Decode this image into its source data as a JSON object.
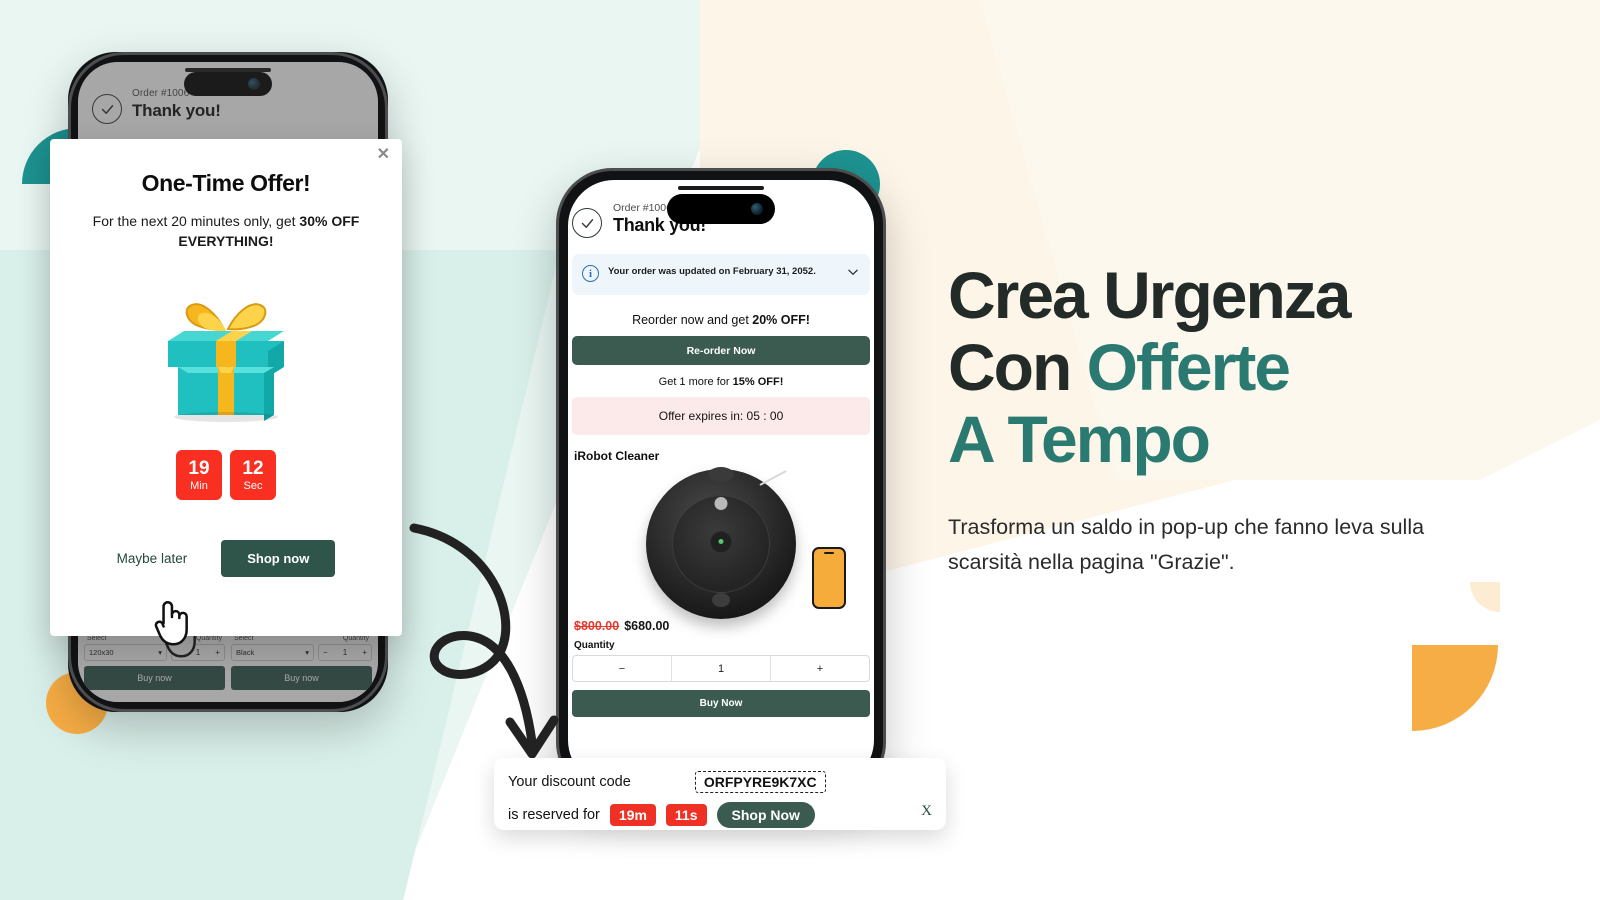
{
  "colors": {
    "teal_dark": "#1d9391",
    "teal_pale": "#b6ded5",
    "orange": "#f7ad45",
    "orange_pale": "#fcecd1",
    "mint_bg": "#e9f6f2",
    "cream_bg": "#fdf5e7",
    "brand_green": "#3b5b50",
    "accent_teal_text": "#2b7a72",
    "alert_red": "#ee3124",
    "timer_red": "#f92f22",
    "price_old_red": "#e23b2e"
  },
  "left_phone": {
    "order_label": "Order #1006",
    "thanks": "Thank you!",
    "check_icon": "check-icon",
    "options": [
      {
        "select_label": "Select",
        "select_value": "120x30",
        "qty_label": "Quantity",
        "qty_minus": "−",
        "qty_value": "1",
        "qty_plus": "+",
        "buy_label": "Buy now"
      },
      {
        "select_label": "Select",
        "select_value": "Black",
        "qty_label": "Quantity",
        "qty_minus": "−",
        "qty_value": "1",
        "qty_plus": "+",
        "buy_label": "Buy now"
      }
    ]
  },
  "popup": {
    "close_icon": "✕",
    "title": "One-Time Offer!",
    "subtitle_part1": "For the next 20 minutes only, get ",
    "subtitle_bold": "30% OFF EVERYTHING!",
    "gift_icon": "gift-box-icon",
    "timer": [
      {
        "value": "19",
        "unit": "Min"
      },
      {
        "value": "12",
        "unit": "Sec"
      }
    ],
    "maybe_later": "Maybe later",
    "shop_now": "Shop now"
  },
  "center_phone": {
    "order_label": "Order #1006",
    "thanks": "Thank you!",
    "check_icon": "check-icon",
    "note_icon": "info-icon",
    "note_text": "Your order was updated on February 31, 2052.",
    "note_chevron": "chevron-down-icon",
    "reorder_text_1": "Reorder now and get ",
    "reorder_text_bold": "20% OFF!",
    "reorder_button": "Re-order Now",
    "upsell_text_1": "Get 1 more for ",
    "upsell_text_bold": "15% OFF!",
    "expire_text": "Offer expires in: 05 : 00",
    "product_name": "iRobot Cleaner",
    "product_icon": "robot-vacuum-icon",
    "price_old": "$800.00",
    "price_new": "$680.00",
    "quantity_label": "Quantity",
    "qty_minus": "−",
    "qty_value": "1",
    "qty_plus": "+",
    "buy_button": "Buy Now"
  },
  "discount_bar": {
    "line1_text": "Your discount code",
    "code": "ORFPYRE9K7XC",
    "line2_text": "is reserved for",
    "minutes_chip": "19m",
    "seconds_chip": "11s",
    "shop_now": "Shop Now",
    "close_icon": "X"
  },
  "copy": {
    "headline_line1": "Crea Urgenza",
    "headline_line2_plain": "Con ",
    "headline_line2_accent": "Offerte",
    "headline_line3_accent": "A Tempo",
    "subcopy": "Trasforma un saldo in pop-up che fanno leva sulla scarsità nella pagina \"Grazie\"."
  }
}
